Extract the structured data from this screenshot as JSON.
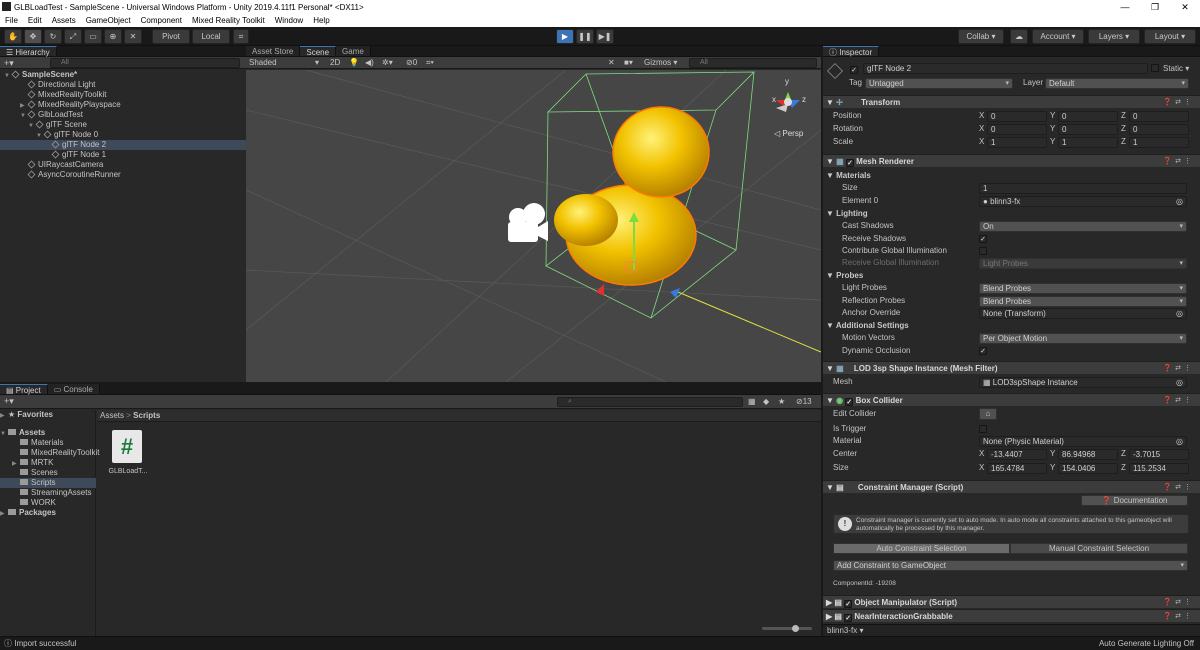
{
  "window": {
    "title": "GLBLoadTest - SampleScene - Universal Windows Platform - Unity 2019.4.11f1 Personal* <DX11>"
  },
  "menu": [
    "File",
    "Edit",
    "Assets",
    "GameObject",
    "Component",
    "Mixed Reality Toolkit",
    "Window",
    "Help"
  ],
  "toolbar": {
    "pivot": "Pivot",
    "local": "Local",
    "collab": "Collab",
    "account": "Account",
    "layers": "Layers",
    "layout": "Layout"
  },
  "hierarchy": {
    "tab": "Hierarchy",
    "search": "All",
    "items": [
      {
        "label": "SampleScene*",
        "indent": 0,
        "arrow": "▼",
        "sel": false
      },
      {
        "label": "Directional Light",
        "indent": 2,
        "arrow": "",
        "sel": false
      },
      {
        "label": "MixedRealityToolkit",
        "indent": 2,
        "arrow": "",
        "sel": false
      },
      {
        "label": "MixedRealityPlayspace",
        "indent": 2,
        "arrow": "▶",
        "sel": false
      },
      {
        "label": "GlbLoadTest",
        "indent": 2,
        "arrow": "▼",
        "sel": false
      },
      {
        "label": "glTF Scene",
        "indent": 3,
        "arrow": "▼",
        "sel": false
      },
      {
        "label": "glTF Node 0",
        "indent": 4,
        "arrow": "▼",
        "sel": false
      },
      {
        "label": "glTF Node 2",
        "indent": 5,
        "arrow": "",
        "sel": true
      },
      {
        "label": "glTF Node 1",
        "indent": 5,
        "arrow": "",
        "sel": false
      },
      {
        "label": "UIRaycastCamera",
        "indent": 2,
        "arrow": "",
        "sel": false
      },
      {
        "label": "AsyncCoroutineRunner",
        "indent": 2,
        "arrow": "",
        "sel": false
      }
    ]
  },
  "scene": {
    "tabs": [
      "Asset Store",
      "Scene",
      "Game"
    ],
    "shading": "Shaded",
    "mode2d": "2D",
    "hidden_count": "0",
    "gizmos": "Gizmos",
    "search": "All",
    "persp": "Persp",
    "axis_y": "y",
    "axis_x": "x",
    "axis_z": "z"
  },
  "project": {
    "tabs": [
      "Project",
      "Console"
    ],
    "count": "13",
    "breadcrumb": [
      "Assets",
      "Scripts"
    ],
    "favorites": "Favorites",
    "assets": "Assets",
    "folders": [
      "Materials",
      "MixedRealityToolkit",
      "MRTK",
      "Scenes",
      "Scripts",
      "StreamingAssets",
      "WORK"
    ],
    "packages": "Packages",
    "file": {
      "name": "GLBLoadT...",
      "glyph": "#"
    }
  },
  "inspector": {
    "tab": "Inspector",
    "object_name": "glTF Node 2",
    "static": "Static",
    "tag_label": "Tag",
    "tag": "Untagged",
    "layer_label": "Layer",
    "layer": "Default",
    "transform": {
      "title": "Transform",
      "rows": [
        {
          "label": "Position",
          "x": "0",
          "y": "0",
          "z": "0"
        },
        {
          "label": "Rotation",
          "x": "0",
          "y": "0",
          "z": "0"
        },
        {
          "label": "Scale",
          "x": "1",
          "y": "1",
          "z": "1"
        }
      ]
    },
    "axis": {
      "x": "X",
      "y": "Y",
      "z": "Z"
    },
    "mesh_renderer": {
      "title": "Mesh Renderer",
      "materials": "Materials",
      "size_label": "Size",
      "size": "1",
      "element0_label": "Element 0",
      "element0": "blinn3-fx",
      "lighting": "Lighting",
      "cast_label": "Cast Shadows",
      "cast": "On",
      "receive_label": "Receive Shadows",
      "contribute_label": "Contribute Global Illumination",
      "receive_gi_label": "Receive Global Illumination",
      "receive_gi": "Light Probes",
      "probes": "Probes",
      "light_probes_label": "Light Probes",
      "light_probes": "Blend Probes",
      "refl_label": "Reflection Probes",
      "refl": "Blend Probes",
      "anchor_label": "Anchor Override",
      "anchor": "None (Transform)",
      "additional": "Additional Settings",
      "motion_label": "Motion Vectors",
      "motion": "Per Object Motion",
      "dyn_label": "Dynamic Occlusion"
    },
    "mesh_filter": {
      "title": "LOD 3sp Shape Instance (Mesh Filter)",
      "mesh_label": "Mesh",
      "mesh": "LOD3spShape Instance"
    },
    "box_collider": {
      "title": "Box Collider",
      "edit_label": "Edit Collider",
      "trigger_label": "Is Trigger",
      "material_label": "Material",
      "material": "None (Physic Material)",
      "center_label": "Center",
      "cx": "-13.4407",
      "cy": "86.94968",
      "cz": "-3.7015",
      "size_label": "Size",
      "sx": "165.4784",
      "sy": "154.0406",
      "sz": "115.2534"
    },
    "constraint": {
      "title": "Constraint Manager (Script)",
      "doc": "Documentation",
      "info": "Constraint manager is currently set to auto mode. In auto mode all constraints attached to this gameobject will automatically be processed by this manager.",
      "auto": "Auto Constraint Selection",
      "manual": "Manual Constraint Selection",
      "add": "Add Constraint to GameObject",
      "component_id": "ComponentId: -19208"
    },
    "object_manipulator": "Object Manipulator (Script)",
    "near_grab": "NearInteractionGrabbable",
    "footer_asset": "blinn3-fx"
  },
  "status": {
    "left": "Import successful",
    "right": "Auto Generate Lighting Off"
  },
  "colors": {
    "accent": "#3d74b8",
    "duck": "#f2c200",
    "duck_outline": "#ff7a00",
    "bounds": "#7fdc7f"
  }
}
